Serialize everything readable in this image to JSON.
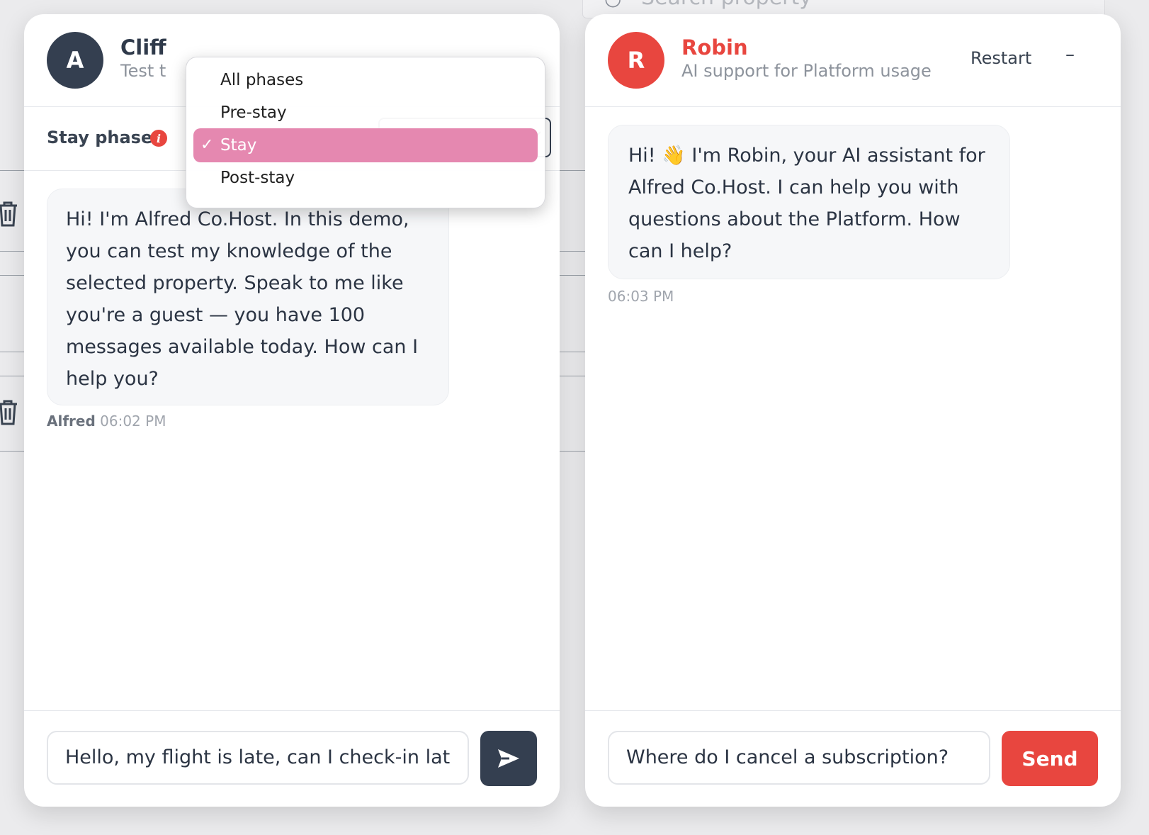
{
  "background": {
    "search_placeholder": "Search property"
  },
  "left_chat": {
    "avatar_letter": "A",
    "title": "Cliff",
    "subtitle": "Test t",
    "phase_label": "Stay phase",
    "phase_info_icon": "info-icon",
    "messages": [
      {
        "text": "Hi! I'm Alfred Co.Host. In this demo, you can test my knowledge of the selected property. Speak to me like you're a guest — you have 100 messages available today. How can I help you?",
        "sender": "Alfred",
        "time": "06:02 PM"
      }
    ],
    "input_value": "Hello, my flight is late, can I check-in lat",
    "send_icon": "paper-plane-icon"
  },
  "dropdown": {
    "options": [
      {
        "label": "All phases",
        "selected": false
      },
      {
        "label": "Pre-stay",
        "selected": false
      },
      {
        "label": "Stay",
        "selected": true
      },
      {
        "label": "Post-stay",
        "selected": false
      }
    ],
    "check_mark": "✓"
  },
  "right_chat": {
    "avatar_letter": "R",
    "title": "Robin",
    "subtitle": "AI support for Platform usage",
    "restart_label": "Restart",
    "minimize_label": "–",
    "messages": [
      {
        "text": "Hi! 👋 I'm Robin, your AI assistant for Alfred Co.Host. I can help you with questions about the Platform. How can I help?",
        "time": "06:03 PM"
      }
    ],
    "input_value": "Where do I cancel a subscription?",
    "send_label": "Send"
  },
  "colors": {
    "brand_dark": "#343f50",
    "accent_red": "#e8463f",
    "dropdown_selected": "#e588b0"
  }
}
